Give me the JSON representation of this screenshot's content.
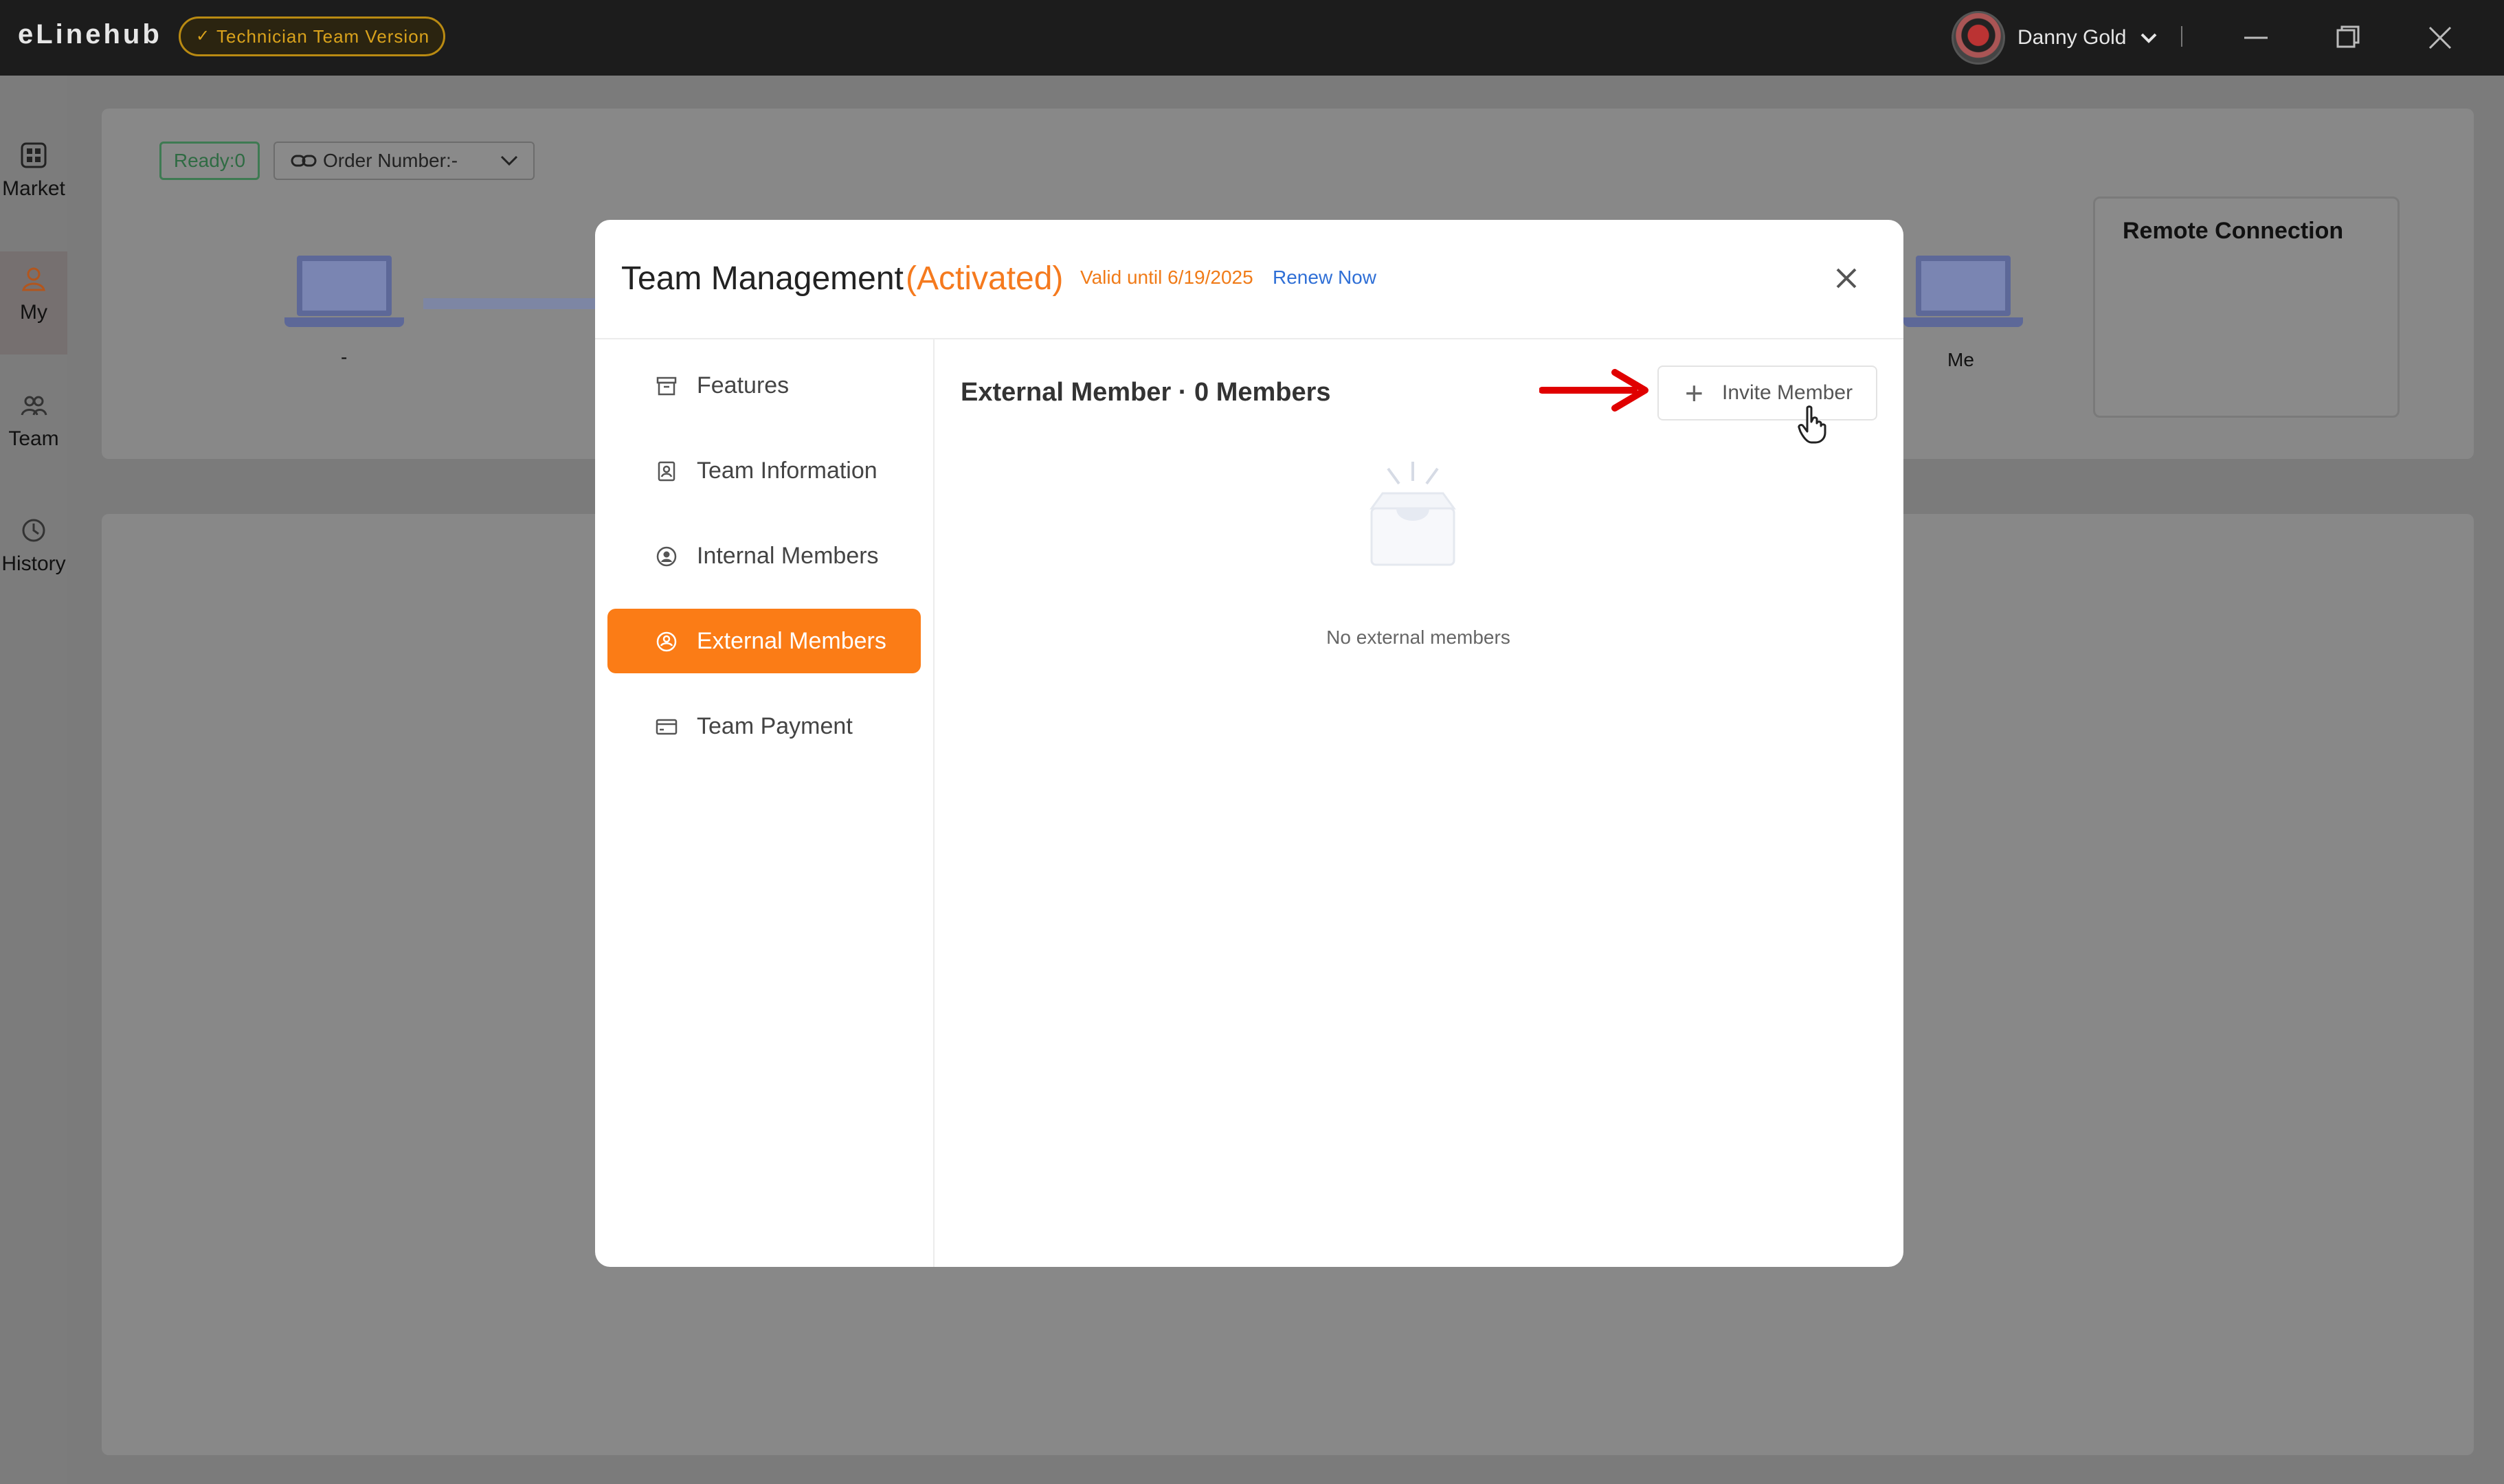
{
  "app": {
    "brand": "eLinehub",
    "version_badge": "Technician Team Version",
    "user_name": "Danny Gold"
  },
  "rail": {
    "items": [
      {
        "label": "Market",
        "icon": "grid-icon"
      },
      {
        "label": "My",
        "icon": "person-icon",
        "active": true
      },
      {
        "label": "Team",
        "icon": "team-icon"
      },
      {
        "label": "History",
        "icon": "history-icon"
      }
    ]
  },
  "background": {
    "ready": "Ready:0",
    "order_number": "Order Number:-",
    "left_device_label": "-",
    "right_device_label": "Me",
    "remote_connection_title": "Remote Connection"
  },
  "modal": {
    "title": "Team Management",
    "status": "(Activated)",
    "valid_until": "Valid until 6/19/2025",
    "renew": "Renew Now",
    "nav": [
      {
        "label": "Features",
        "icon": "box-icon"
      },
      {
        "label": "Team Information",
        "icon": "id-card-icon"
      },
      {
        "label": "Internal Members",
        "icon": "user-circle-icon"
      },
      {
        "label": "External Members",
        "icon": "external-user-icon",
        "active": true
      },
      {
        "label": "Team Payment",
        "icon": "card-icon"
      }
    ],
    "content_title": "External Member · 0 Members",
    "invite_button": "Invite Member",
    "empty_text": "No external members"
  },
  "colors": {
    "accent": "#fb7c16",
    "status_orange": "#f57a1e",
    "link_blue": "#2f6fd6",
    "annotation_red": "#e00000"
  }
}
